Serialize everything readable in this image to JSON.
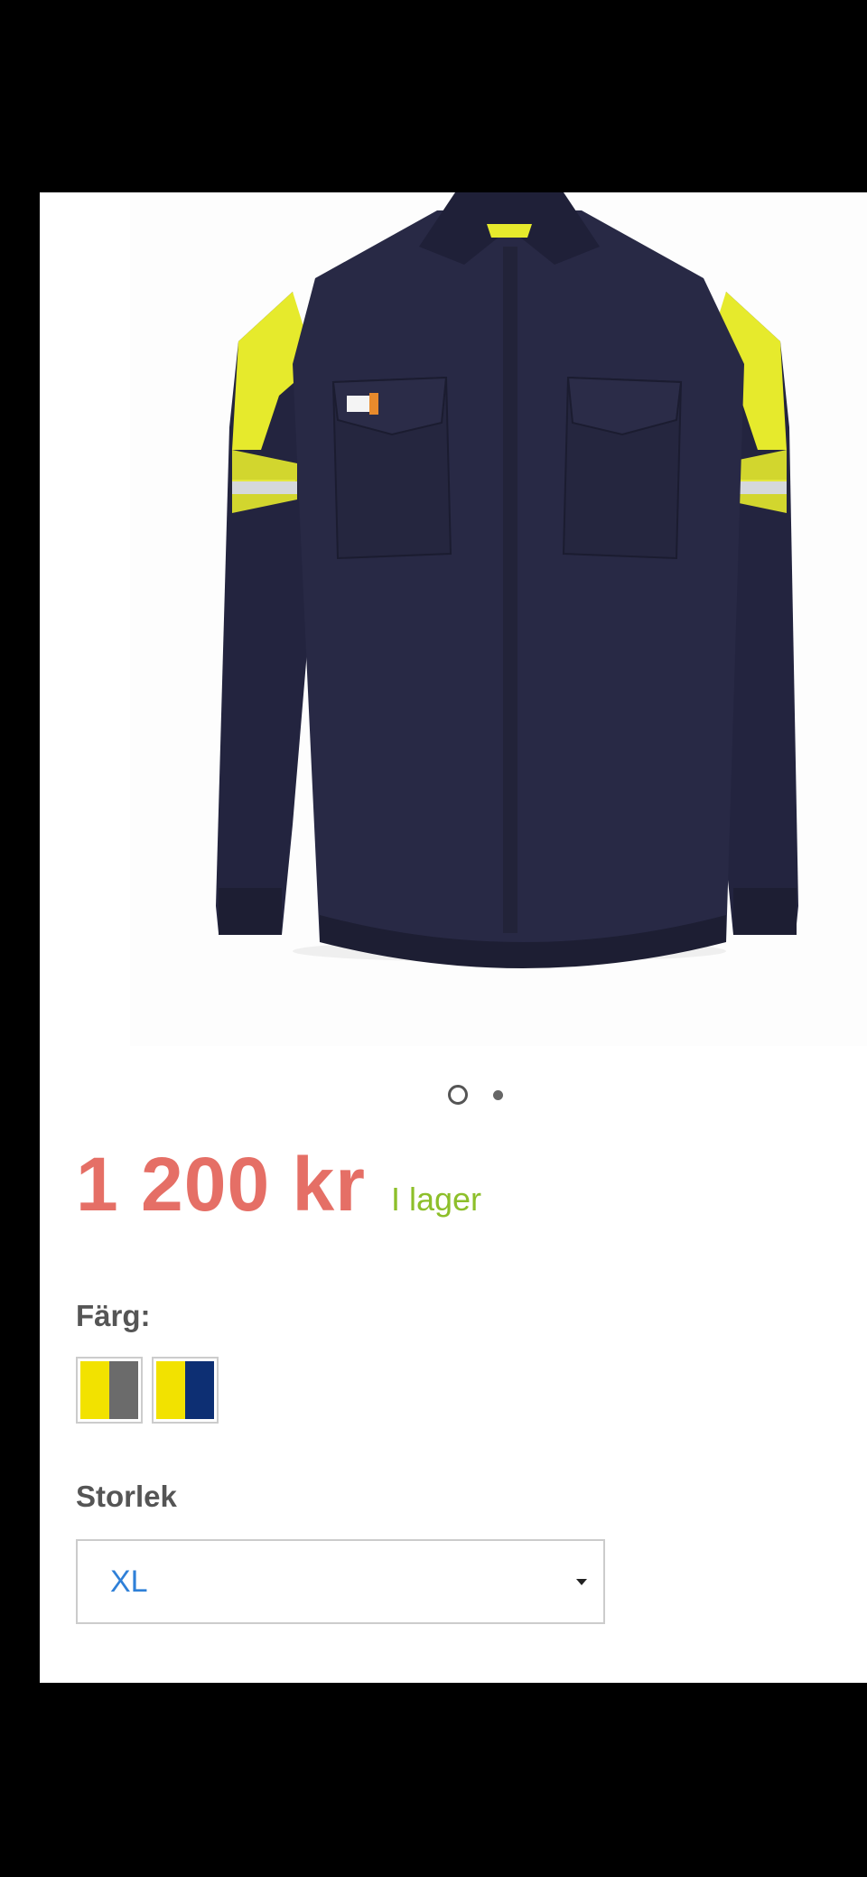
{
  "product": {
    "image_name": "flame-retardant-work-shirt",
    "gallery": {
      "count": 2,
      "active_index": 0
    },
    "price": "1 200 kr",
    "stock_status": "I lager"
  },
  "color_picker": {
    "label": "Färg:",
    "options": [
      {
        "name": "yellow-grey",
        "colors": [
          "#f2e200",
          "#6b6b6b"
        ]
      },
      {
        "name": "yellow-navy",
        "colors": [
          "#f2e200",
          "#0d2f73"
        ]
      }
    ]
  },
  "size_picker": {
    "label": "Storlek",
    "selected": "XL"
  },
  "colors": {
    "price": "#e56f66",
    "stock": "#8dbf2a",
    "select_value": "#2f80d8"
  }
}
